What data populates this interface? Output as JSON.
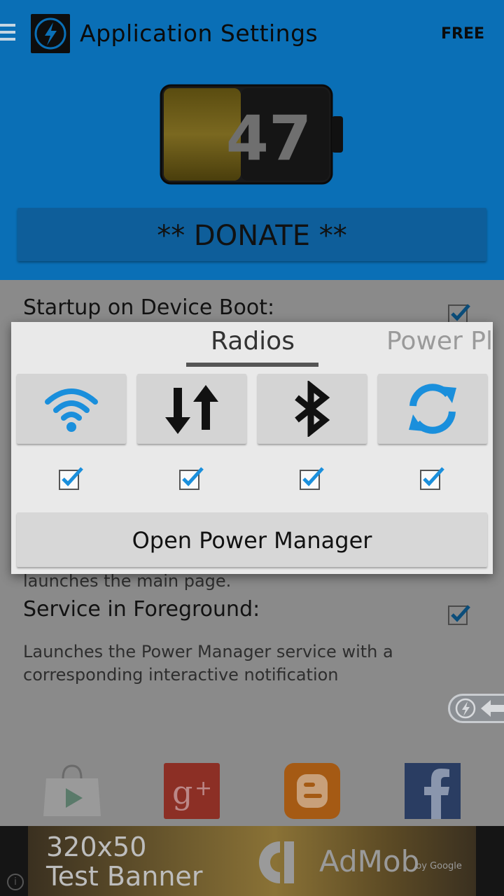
{
  "header": {
    "title": "Application Settings",
    "badge": "FREE",
    "battery_level": "47",
    "donate_label": "** DONATE **"
  },
  "settings": {
    "items": [
      {
        "title": "Startup on Device Boot:",
        "checked": true
      },
      {
        "description_tail": "launches the main page."
      },
      {
        "title": "Service in Foreground:",
        "description": "Launches the Power Manager service with a corresponding interactive notification",
        "checked": true
      }
    ]
  },
  "dialog": {
    "tabs": [
      {
        "label": "Radios",
        "active": true
      },
      {
        "label": "Power Pl",
        "active": false
      }
    ],
    "toggles": [
      {
        "icon": "wifi-icon",
        "checked": true,
        "color": "#1a8fdc"
      },
      {
        "icon": "mobile-data-icon",
        "checked": true,
        "color": "#111111"
      },
      {
        "icon": "bluetooth-icon",
        "checked": true,
        "color": "#111111"
      },
      {
        "icon": "sync-icon",
        "checked": true,
        "color": "#1a8fdc"
      }
    ],
    "open_button_label": "Open Power Manager"
  },
  "dock": {
    "icons": [
      "play-store-icon",
      "google-plus-icon",
      "blogger-icon",
      "facebook-icon"
    ]
  },
  "ad": {
    "size": "320x50",
    "label": "Test Banner",
    "brand": "AdMob",
    "brand_sub": "by Google"
  },
  "colors": {
    "header_blue": "#0a6fb6",
    "accent_blue": "#1a8fdc",
    "dialog_bg": "#e9e9e9"
  }
}
